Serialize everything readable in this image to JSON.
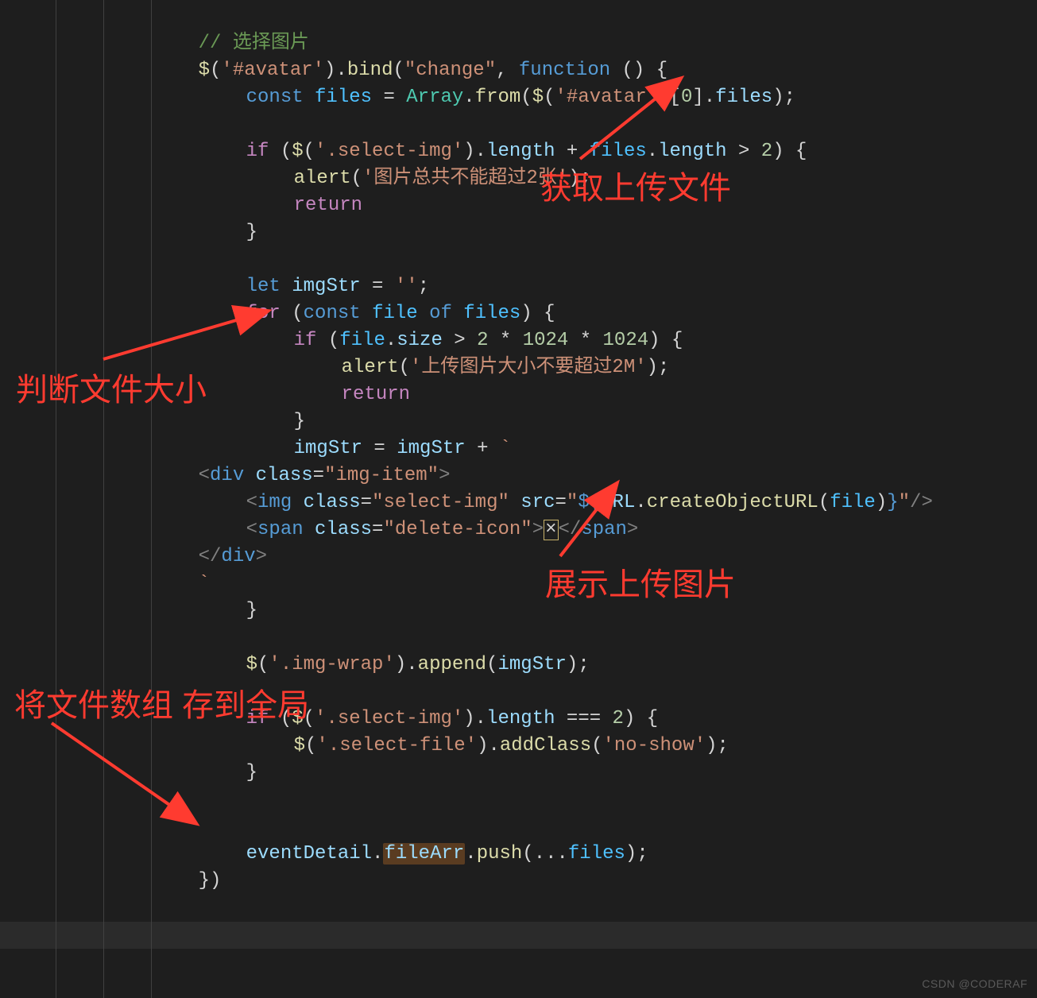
{
  "code": {
    "comment": "// 选择图片",
    "l1": {
      "bind": "bind",
      "change": "\"change\"",
      "function": "function"
    },
    "l2": {
      "const": "const",
      "files": "files",
      "Array": "Array",
      "from": "from",
      "avatar": "'#avatar'",
      "zero": "0",
      "filesProp": "files"
    },
    "l3": {
      "if": "if",
      "selectimg": "'.select-img'",
      "length": "length",
      "filesVar": "files",
      "lengthProp": "length",
      "two": "2"
    },
    "l4": {
      "alert": "alert",
      "msg": "'图片总共不能超过2张'"
    },
    "l5": {
      "return": "return"
    },
    "l7": {
      "let": "let",
      "imgStr": "imgStr",
      "empty": "''"
    },
    "l8": {
      "for": "for",
      "const": "const",
      "file": "file",
      "of": "of",
      "files": "files"
    },
    "l9": {
      "if": "if",
      "file": "file",
      "size": "size",
      "two": "2",
      "k1": "1024",
      "k2": "1024"
    },
    "l10": {
      "alert": "alert",
      "msg": "'上传图片大小不要超过2M'"
    },
    "l11": {
      "return": "return"
    },
    "l13": {
      "imgStr": "imgStr",
      "imgStr2": "imgStr"
    },
    "l14": {
      "divOpen": "<div class=\"img-item\">"
    },
    "l15": {
      "imgOpen": "<img class=\"select-img\" src=\"",
      "tmplOpen": "${",
      "URL": "URL",
      "createObjectURL": "createObjectURL",
      "file": "file",
      "tmplClose": "}",
      "imgClose": "\"/>"
    },
    "l16": {
      "spanOpen": "<span class=\"delete-icon\">",
      "x": "×",
      "spanClose": "</span>"
    },
    "l17": {
      "divClose": "</div>"
    },
    "l20": {
      "imgwrap": "'.img-wrap'",
      "append": "append",
      "imgStr": "imgStr"
    },
    "l21": {
      "if": "if",
      "selectimg": "'.select-img'",
      "length": "length",
      "two": "2"
    },
    "l22": {
      "selectfile": "'.select-file'",
      "addClass": "addClass",
      "noshow": "'no-show'"
    },
    "l24": {
      "eventDetail": "eventDetail",
      "fileArr": "fileArr",
      "push": "push",
      "files": "files"
    }
  },
  "annotations": {
    "a1": "获取上传文件",
    "a2": "判断文件大小",
    "a3": "展示上传图片",
    "a4": "将文件数组 存到全局"
  },
  "watermark": "CSDN @CODERAF"
}
